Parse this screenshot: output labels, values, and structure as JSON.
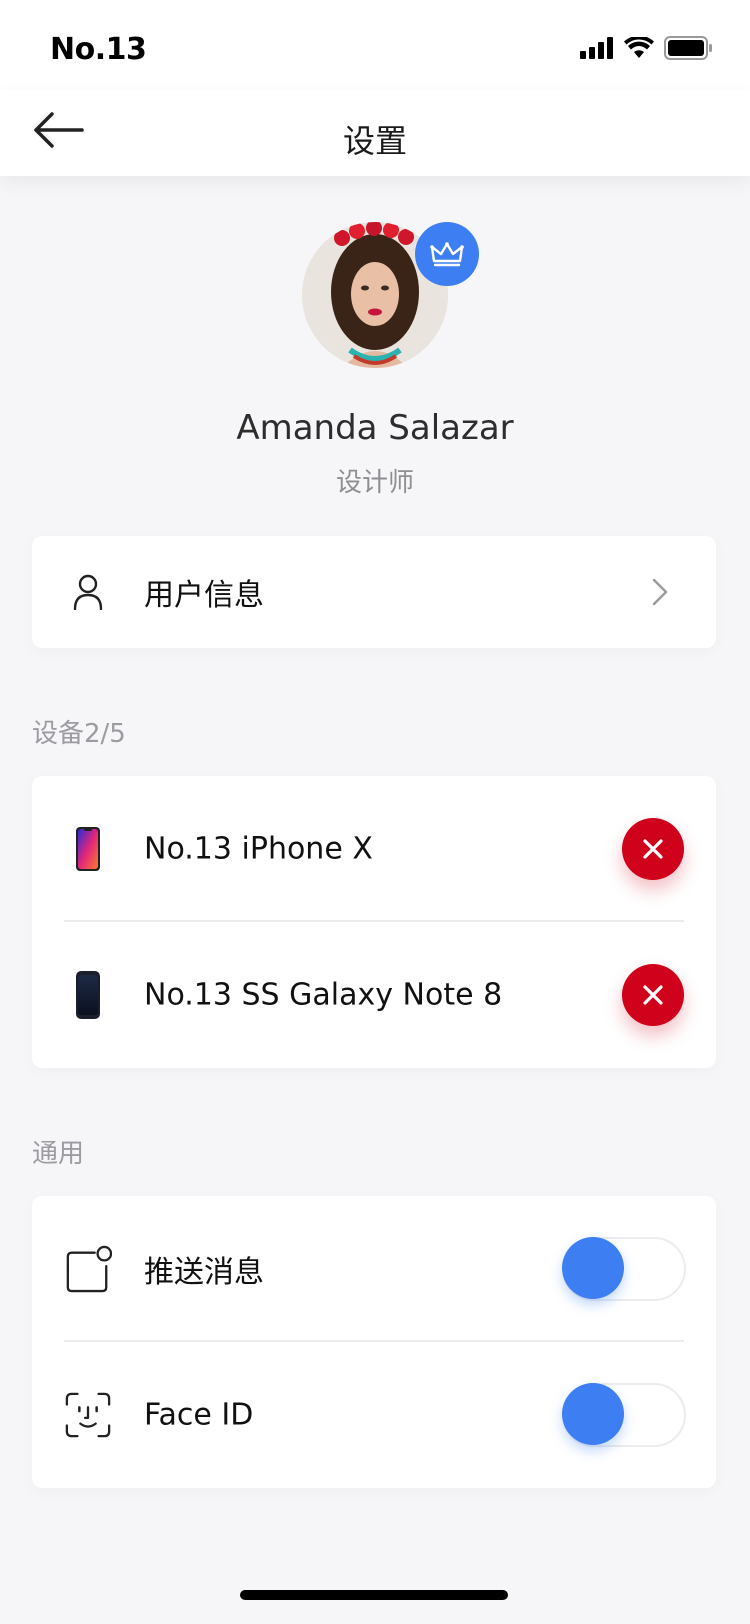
{
  "status_bar": {
    "carrier": "No.13"
  },
  "nav": {
    "title": "设置"
  },
  "profile": {
    "name": "Amanda Salazar",
    "role": "设计师"
  },
  "user_info": {
    "label": "用户信息"
  },
  "devices": {
    "section_label": "设备2/5",
    "items": [
      {
        "label": "No.13 iPhone X"
      },
      {
        "label": "No.13 SS Galaxy Note 8"
      }
    ]
  },
  "general": {
    "section_label": "通用",
    "items": [
      {
        "label": "推送消息",
        "enabled": false
      },
      {
        "label": "Face ID",
        "enabled": false
      }
    ]
  },
  "colors": {
    "accent": "#3d7ef2",
    "danger": "#d0021b",
    "background": "#f6f6f8"
  }
}
